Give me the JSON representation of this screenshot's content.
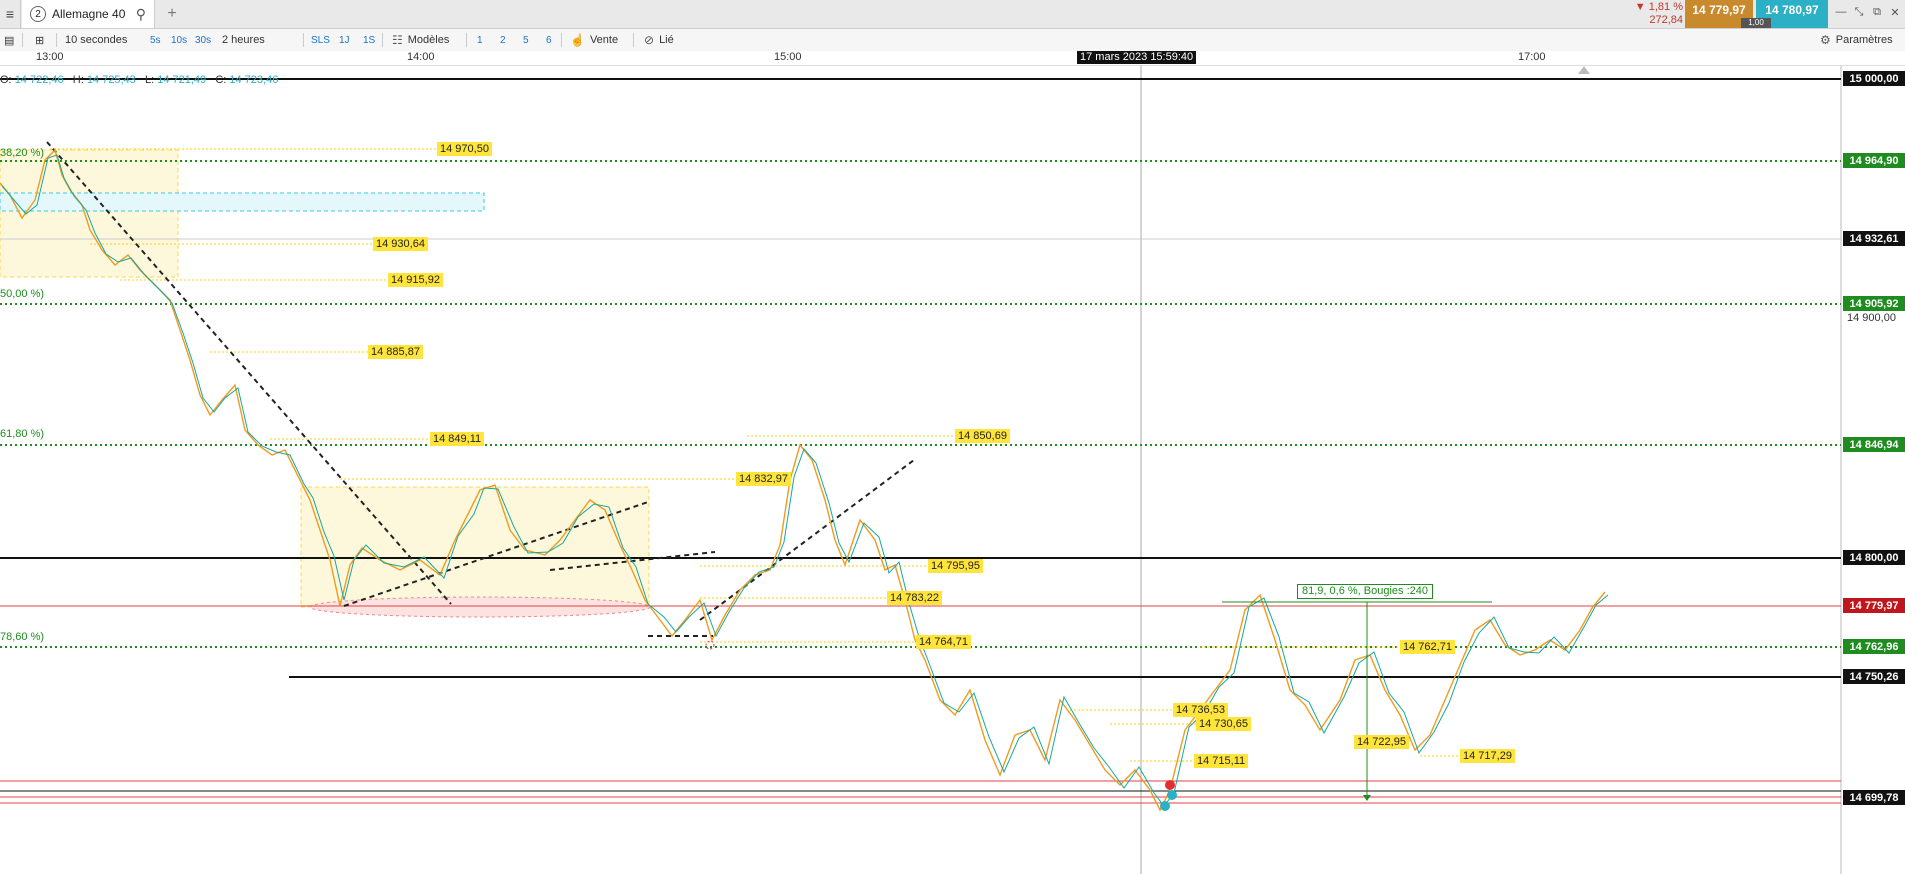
{
  "topbar": {
    "tab_number": "2",
    "tab_title": "Allemagne 40",
    "change_pct": "▼ 1,81 %",
    "change_pts": "272,84",
    "bid": "14 779,97",
    "ask": "14 780,97",
    "spread": "1,00"
  },
  "toolbar": {
    "interval": "10 secondes",
    "i5s": "5s",
    "i10s": "10s",
    "i30s": "30s",
    "period": "2 heures",
    "sls": "SLS",
    "d1j": "1J",
    "d1s": "1S",
    "models": "Modèles",
    "n1": "1",
    "n2": "2",
    "n3": "5",
    "n4": "6",
    "sell": "Vente",
    "linked": "Lié",
    "settings": "Paramètres"
  },
  "time_axis": {
    "t1": "13:00",
    "t2": "14:00",
    "t3": "15:00",
    "t4": "17:00",
    "crosshair": "17 mars 2023 15:59:40"
  },
  "ohlc": {
    "o_label": "O:",
    "o": "14 722,46",
    "h_label": "H:",
    "h": "14 725,43",
    "l_label": "L:",
    "l": "14 721,49",
    "c_label": "C:",
    "c": "14 723,46"
  },
  "price_scale": {
    "p15000": "15 000,00",
    "p14964": "14 964,90",
    "p14932": "14 932,61",
    "p14905": "14 905,92",
    "p14900": "14 900,00",
    "p14846": "14 846,94",
    "p14800": "14 800,00",
    "p14779": "14 779,97",
    "p14762": "14 762,96",
    "p14750": "14 750,26",
    "p14699": "14 699,78"
  },
  "levels": {
    "l14970": "14 970,50",
    "l14930": "14 930,64",
    "l14915": "14 915,92",
    "l14885": "14 885,87",
    "l14849": "14 849,11",
    "l14850": "14 850,69",
    "l14832": "14 832,97",
    "l14795": "14 795,95",
    "l14783": "14 783,22",
    "l14764": "14 764,71",
    "l14762": "14 762,71",
    "l14736": "14 736,53",
    "l14730": "14 730,65",
    "l14722": "14 722,95",
    "l14717": "14 717,29",
    "l14715": "14 715,11"
  },
  "fibs": {
    "f382": "38,20 %)",
    "f500": "50,00 %)",
    "f618": "61,80 %)",
    "f786": "78,60 %)"
  },
  "measure": {
    "label": "81,9, 0,6 %, Bougies :240"
  },
  "colors": {
    "bid_bg": "#c9892d",
    "ask_bg": "#2bb0c6",
    "level_label_bg": "#ffe53b",
    "fib_green": "#1e8c1e",
    "current_price_red": "#c0161d"
  }
}
